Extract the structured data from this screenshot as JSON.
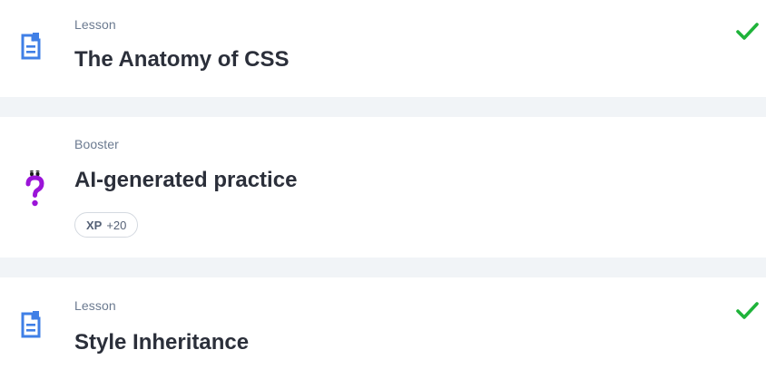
{
  "items": [
    {
      "type": "Lesson",
      "title": "The Anatomy of CSS",
      "icon": "document-icon",
      "completed": true,
      "status_icon": "checkmark-icon"
    },
    {
      "type": "Booster",
      "title": "AI-generated practice",
      "icon": "question-mark-icon",
      "completed": false,
      "xp_badge": {
        "label": "XP",
        "value": "+20"
      }
    },
    {
      "type": "Lesson",
      "title": "Style Inheritance",
      "icon": "document-icon",
      "completed": true,
      "status_icon": "checkmark-icon"
    }
  ],
  "colors": {
    "background": "#f1f4f7",
    "card": "#ffffff",
    "lesson_icon": "#3f7fe6",
    "booster_icon": "#9b14d8",
    "check": "#1fb33a",
    "title_text": "#2b2f3a",
    "type_text": "#6b7a90"
  }
}
